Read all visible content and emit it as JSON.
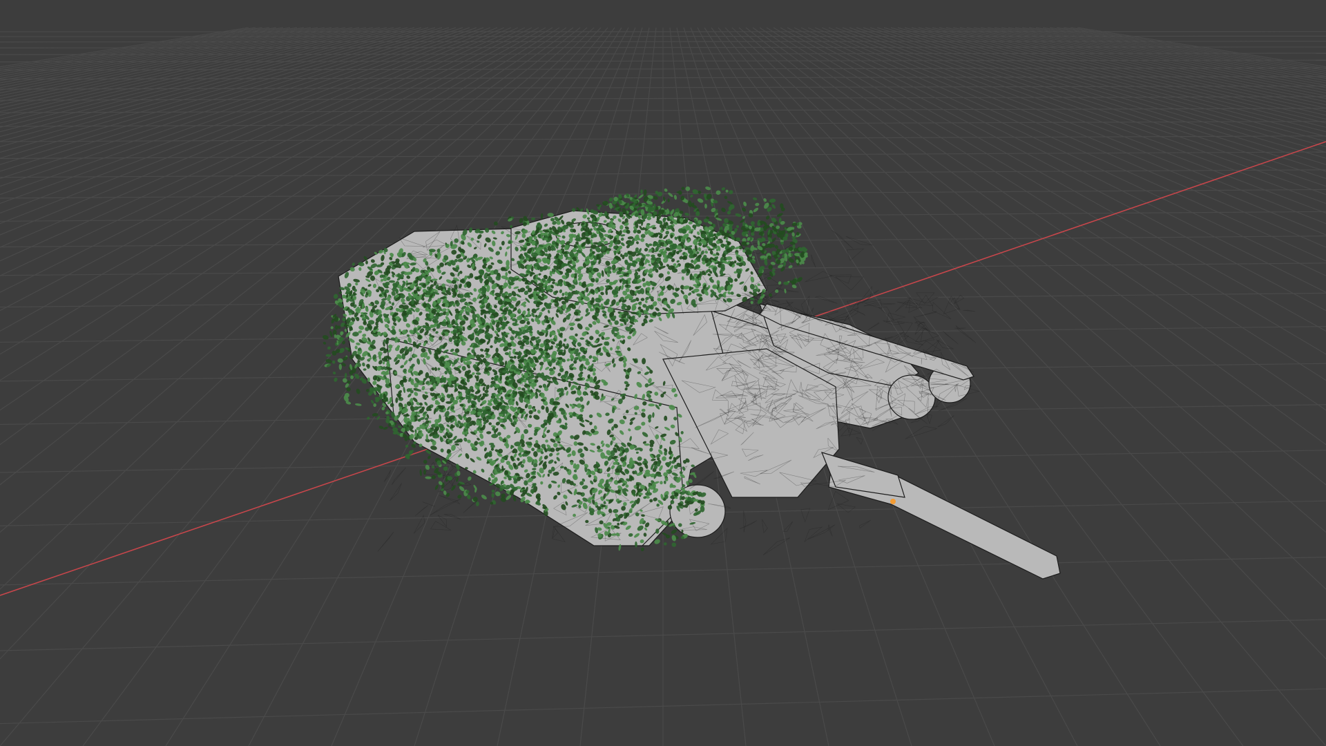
{
  "app": {
    "view": "3D Viewport",
    "shading": "wireframe-solid"
  },
  "scene": {
    "object": "tank-model-with-foliage-camouflage",
    "grid_visible": true,
    "x_axis_visible": true
  },
  "colors": {
    "background": "#3d3d3d",
    "grid_line": "#4a4a4a",
    "x_axis": "#c7464b",
    "mesh_fill": "#b9b9b9",
    "mesh_edge": "#1c1c1c",
    "foliage_dark": "#234b1f",
    "foliage_mid": "#2f6530",
    "foliage_light": "#4b8a4a",
    "origin_dot": "#f39c34"
  }
}
